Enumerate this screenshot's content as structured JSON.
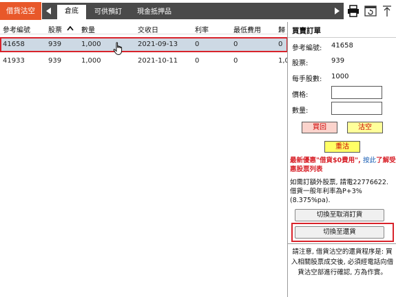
{
  "header": {
    "badge": "借貨沽空",
    "tabs": [
      {
        "label": "倉底",
        "active": true
      },
      {
        "label": "可供預訂",
        "active": false
      },
      {
        "label": "現金抵押品",
        "active": false
      }
    ],
    "toolbar_icons": [
      "print-icon",
      "refresh-icon",
      "pin-icon"
    ]
  },
  "table": {
    "headers": [
      "參考編號",
      "股票",
      "數量",
      "交收日",
      "利率",
      "最低費用",
      "歸"
    ],
    "sort_column": "股票",
    "rows": [
      {
        "ref": "41658",
        "stock": "939",
        "qty": "1,000",
        "date": "2021-09-13",
        "rate": "0",
        "min_fee": "0",
        "extra": "0"
      },
      {
        "ref": "41933",
        "stock": "939",
        "qty": "1,000",
        "date": "2021-10-11",
        "rate": "0",
        "min_fee": "0",
        "extra": "1,0"
      }
    ]
  },
  "order_panel": {
    "title": "買賣訂單",
    "ref_label": "參考編號:",
    "ref_value": "41658",
    "stock_label": "股票:",
    "stock_value": "939",
    "lot_label": "每手股數:",
    "lot_value": "1000",
    "price_label": "價格:",
    "price_value": "",
    "qty_label": "數量:",
    "qty_value": "",
    "buyback_label": "買回",
    "shortsell_label": "沽空",
    "reset_label": "重沽",
    "promo_text": "最新優惠\"借貨$0費用\", ",
    "promo_link": "按此",
    "promo_text2": "了解受惠股票列表",
    "info_text": "如需訂額外股票, 請電22776622.",
    "rate_text": "借貨一般年利率為P+3% (8.375%pa).",
    "cancel_order_label": "切換至取消訂貨",
    "return_stock_label": "切換至還貨",
    "notice": "請注意, 借貨沽空的還貨程序是: 買入相關股票成交後, 必須經電話向借貨沽空部進行確認, 方為作實。"
  },
  "colors": {
    "badge": "#e8582a",
    "tabstrip": "#4a4a4a",
    "selected_row": "#cdd9e4",
    "highlight": "#d8222a",
    "buyback_btn": "#fbd3cc",
    "shortsell_btn": "#ffff9a",
    "reset_btn": "#ffff66"
  }
}
